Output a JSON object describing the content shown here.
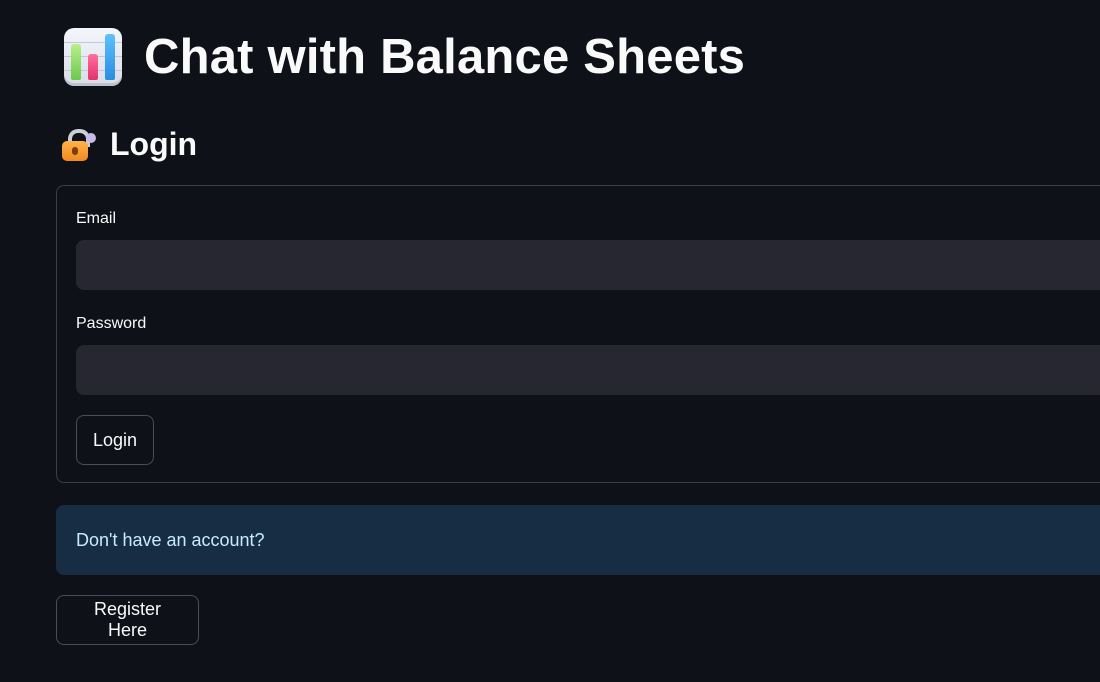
{
  "header": {
    "title": "Chat with Balance Sheets",
    "icon": "bar-chart-icon"
  },
  "login": {
    "heading": "Login",
    "icon": "locked-with-key-icon",
    "email_label": "Email",
    "email_value": "",
    "password_label": "Password",
    "password_value": "",
    "submit_label": "Login"
  },
  "register": {
    "info_text": "Don't have an account?",
    "button_label": "Register Here"
  },
  "colors": {
    "background": "#0e1117",
    "input_bg": "#262730",
    "info_bg": "#172d43",
    "info_text": "#c7ebff",
    "chart_bar_green": "#8fdc6a",
    "chart_bar_pink": "#f0477f",
    "chart_bar_blue": "#3aa6f5"
  }
}
